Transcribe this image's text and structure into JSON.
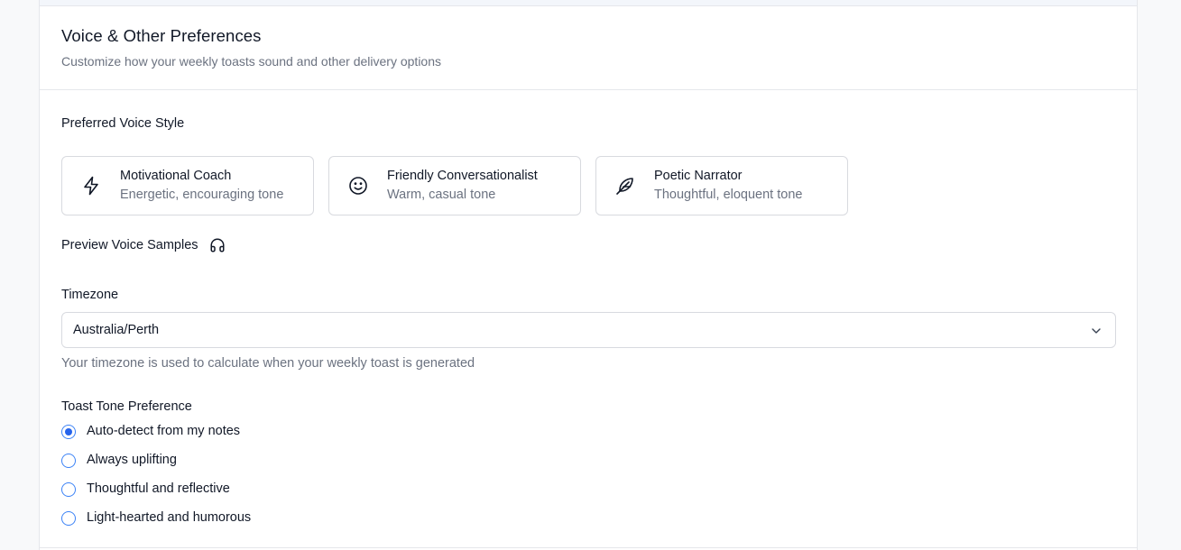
{
  "card": {
    "title": "Voice & Other Preferences",
    "subtitle": "Customize how your weekly toasts sound and other delivery options"
  },
  "voice": {
    "section_label": "Preferred Voice Style",
    "options": [
      {
        "name": "Motivational Coach",
        "description": "Energetic, encouraging tone",
        "icon": "lightning-icon"
      },
      {
        "name": "Friendly Conversationalist",
        "description": "Warm, casual tone",
        "icon": "smile-icon"
      },
      {
        "name": "Poetic Narrator",
        "description": "Thoughtful, eloquent tone",
        "icon": "feather-icon"
      }
    ],
    "preview_label": "Preview Voice Samples",
    "preview_icon": "headphones-icon"
  },
  "timezone": {
    "label": "Timezone",
    "value": "Australia/Perth",
    "help": "Your timezone is used to calculate when your weekly toast is generated"
  },
  "tone": {
    "label": "Toast Tone Preference",
    "options": [
      {
        "label": "Auto-detect from my notes",
        "checked": true
      },
      {
        "label": "Always uplifting",
        "checked": false
      },
      {
        "label": "Thoughtful and reflective",
        "checked": false
      },
      {
        "label": "Light-hearted and humorous",
        "checked": false
      }
    ]
  },
  "colors": {
    "accent": "#2563eb",
    "border": "#d8dadf",
    "muted_text": "#6b7280"
  }
}
